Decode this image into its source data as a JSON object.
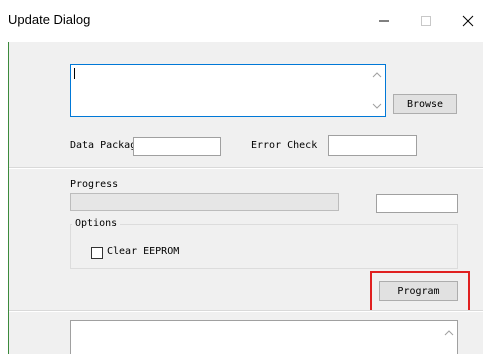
{
  "window": {
    "title": "Update Dialog"
  },
  "icons": {
    "minimize": "minimize-icon",
    "maximize": "maximize-icon",
    "close": "close-icon"
  },
  "buttons": {
    "browse": "Browse",
    "program": "Program"
  },
  "fields": {
    "file_path_value": "",
    "data_package_label": "Data Package",
    "data_package_value": "",
    "error_check_label": "Error Check",
    "error_check_value": "",
    "progress_label": "Progress",
    "progress_percent": 0,
    "progress_text_value": ""
  },
  "options": {
    "title": "Options",
    "clear_eeprom_label": "Clear EEPROM",
    "clear_eeprom_checked": false
  },
  "log": {
    "value": ""
  },
  "colors": {
    "highlight": "#e02020",
    "focus_border": "#0078d7"
  }
}
